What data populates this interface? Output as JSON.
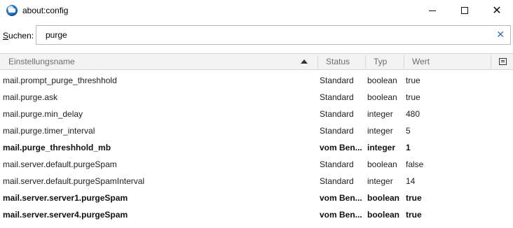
{
  "window": {
    "title": "about:config",
    "icon": "thunderbird-icon"
  },
  "search": {
    "label_prefix": "S",
    "label_rest": "uchen:",
    "value": "purge",
    "clear_icon": "clear-x-icon"
  },
  "table": {
    "headers": {
      "name": "Einstellungsname",
      "status": "Status",
      "typ": "Typ",
      "wert": "Wert"
    },
    "rows": [
      {
        "name": "mail.prompt_purge_threshhold",
        "status": "Standard",
        "typ": "boolean",
        "wert": "true",
        "modified": false
      },
      {
        "name": "mail.purge.ask",
        "status": "Standard",
        "typ": "boolean",
        "wert": "true",
        "modified": false
      },
      {
        "name": "mail.purge.min_delay",
        "status": "Standard",
        "typ": "integer",
        "wert": "480",
        "modified": false
      },
      {
        "name": "mail.purge.timer_interval",
        "status": "Standard",
        "typ": "integer",
        "wert": "5",
        "modified": false
      },
      {
        "name": "mail.purge_threshhold_mb",
        "status": "vom Ben...",
        "typ": "integer",
        "wert": "1",
        "modified": true
      },
      {
        "name": "mail.server.default.purgeSpam",
        "status": "Standard",
        "typ": "boolean",
        "wert": "false",
        "modified": false
      },
      {
        "name": "mail.server.default.purgeSpamInterval",
        "status": "Standard",
        "typ": "integer",
        "wert": "14",
        "modified": false
      },
      {
        "name": "mail.server.server1.purgeSpam",
        "status": "vom Ben...",
        "typ": "boolean",
        "wert": "true",
        "modified": true
      },
      {
        "name": "mail.server.server4.purgeSpam",
        "status": "vom Ben...",
        "typ": "boolean",
        "wert": "true",
        "modified": true
      }
    ]
  }
}
